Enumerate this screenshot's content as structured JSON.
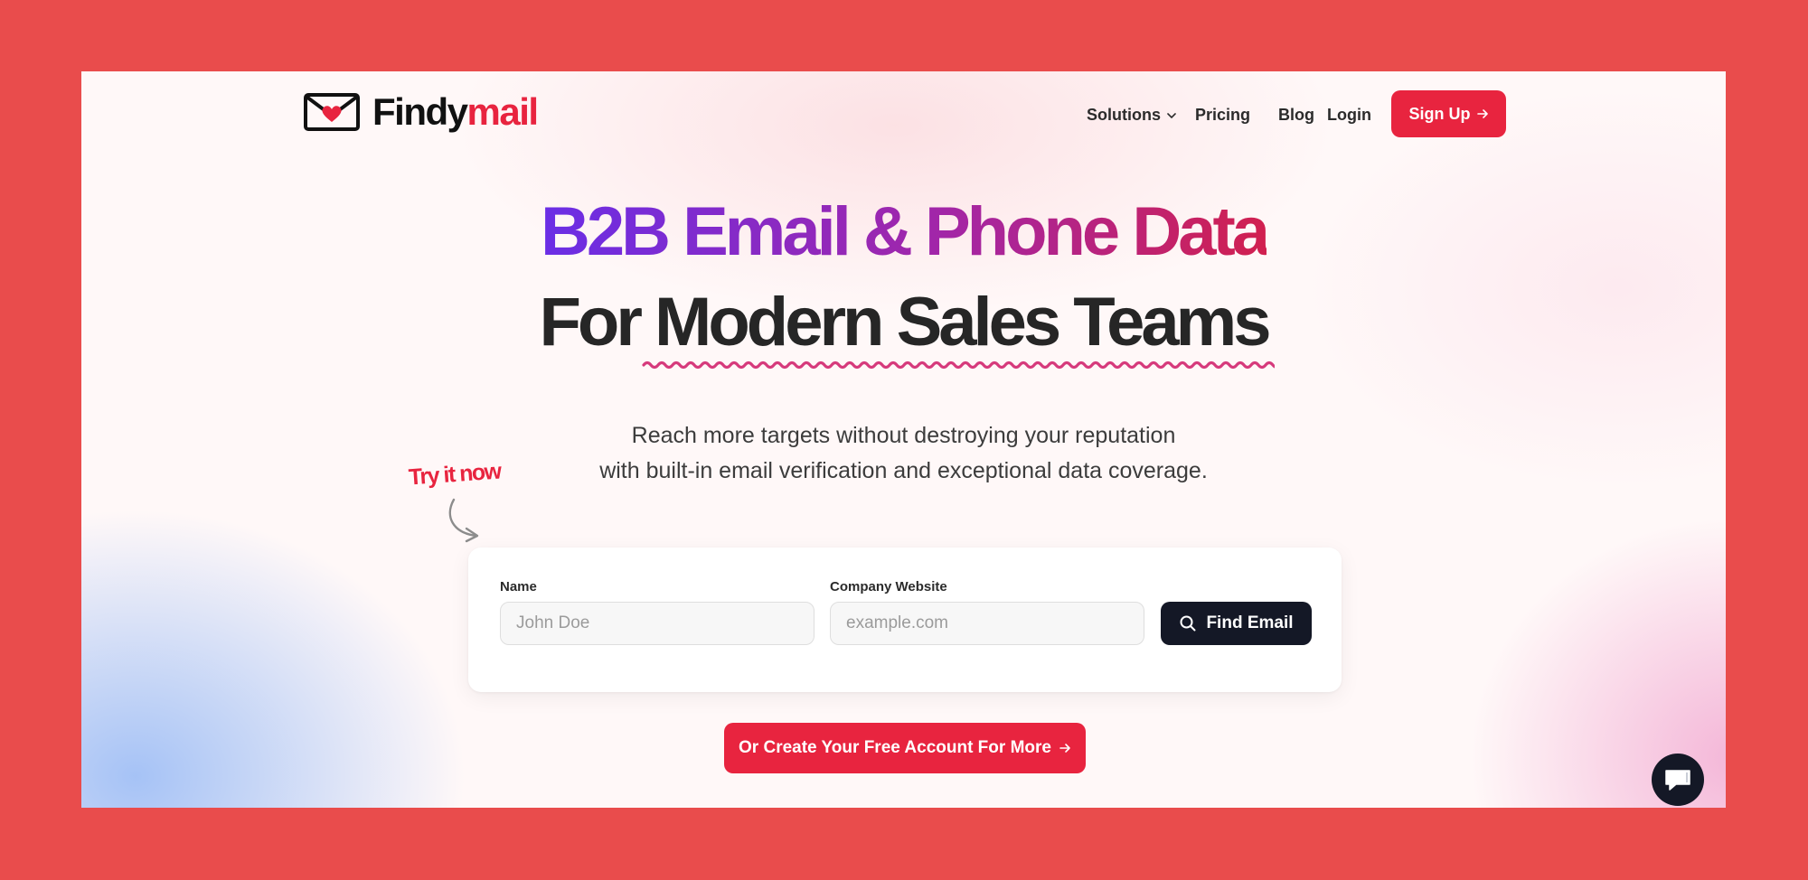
{
  "brand": {
    "name_part1": "Findy",
    "name_part2": "mail"
  },
  "nav": {
    "solutions": "Solutions",
    "pricing": "Pricing",
    "blog": "Blog",
    "login": "Login",
    "signup": "Sign Up"
  },
  "hero": {
    "headline_top": "B2B Email & Phone Data",
    "headline_bottom_part1": "For ",
    "headline_bottom_part2": "Modern Sales Teams",
    "subtitle_line1": "Reach more targets without destroying your reputation",
    "subtitle_line2": "with built-in email verification and exceptional data coverage.",
    "try_label": "Try it now"
  },
  "form": {
    "name_label": "Name",
    "name_placeholder": "John Doe",
    "company_label": "Company Website",
    "company_placeholder": "example.com",
    "find_button": "Find Email"
  },
  "cta": {
    "label": "Or Create Your Free Account For More"
  },
  "colors": {
    "brand_red": "#e8243f",
    "dark_button": "#141826",
    "page_background": "#e94c4c",
    "headline_gradient_start": "#6a2ee6",
    "headline_gradient_end": "#d1204f"
  },
  "icons": [
    "envelope-heart-icon",
    "chevron-down-icon",
    "arrow-right-icon",
    "search-icon",
    "curved-arrow-icon",
    "chat-icon"
  ]
}
